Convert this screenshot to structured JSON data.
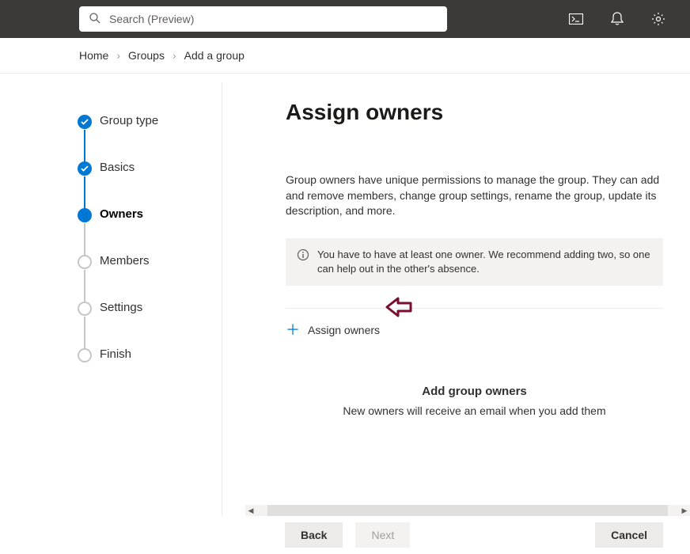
{
  "search": {
    "placeholder": "Search (Preview)"
  },
  "breadcrumb": {
    "home": "Home",
    "groups": "Groups",
    "addgroup": "Add a group"
  },
  "steps": {
    "grouptype": "Group type",
    "basics": "Basics",
    "owners": "Owners",
    "members": "Members",
    "settings": "Settings",
    "finish": "Finish"
  },
  "content": {
    "heading": "Assign owners",
    "description": "Group owners have unique permissions to manage the group. They can add and remove members, change group settings, rename the group, update its description, and more.",
    "infobox": "You have to have at least one owner. We recommend adding two, so one can help out in the other's absence.",
    "assign_link": "Assign owners",
    "empty_title": "Add group owners",
    "empty_sub": "New owners will receive an email when you add them"
  },
  "footer": {
    "back": "Back",
    "next": "Next",
    "cancel": "Cancel"
  }
}
